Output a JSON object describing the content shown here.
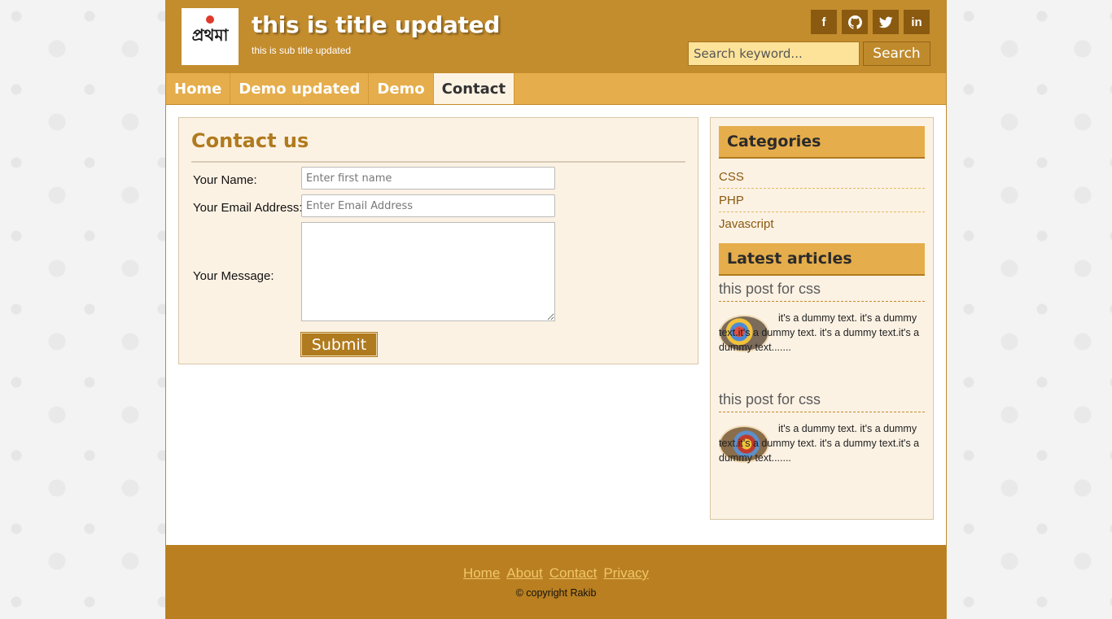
{
  "site": {
    "title": "this is title updated",
    "subtitle": "this is sub title updated",
    "logo_text": "প্রথমা"
  },
  "social": [
    {
      "icon": "facebook-icon",
      "glyph": "f"
    },
    {
      "icon": "github-icon",
      "glyph": ""
    },
    {
      "icon": "twitter-icon",
      "glyph": ""
    },
    {
      "icon": "linkedin-icon",
      "glyph": "in"
    }
  ],
  "search": {
    "placeholder": "Search keyword...",
    "button_label": "Search"
  },
  "nav": {
    "items": [
      "Home",
      "Demo updated",
      "Demo",
      "Contact"
    ],
    "active": "Contact"
  },
  "contact": {
    "title": "Contact us",
    "name_label": "Your Name:",
    "name_placeholder": "Enter first name",
    "email_label": "Your Email Address:",
    "email_placeholder": "Enter Email Address",
    "message_label": "Your Message:",
    "submit_label": "Submit"
  },
  "sidebar": {
    "categories_title": "Categories",
    "categories": [
      "CSS",
      "PHP",
      "Javascript"
    ],
    "latest_title": "Latest articles",
    "articles": [
      {
        "title": "this post for css",
        "excerpt": "it's a dummy text. it's a dummy text.it's a dummy text. it's a dummy text.it's a dummy text......."
      },
      {
        "title": "this post for css",
        "excerpt": "it's a dummy text. it's a dummy text.it's a dummy text. it's a dummy text.it's a dummy text......."
      }
    ]
  },
  "footer": {
    "links": [
      "Home",
      "About",
      "Contact",
      "Privacy"
    ],
    "copyright": "© copyright Rakib"
  },
  "colors": {
    "header": "#c38c2d",
    "nav": "#e5ad4b",
    "accent": "#b07a1e",
    "footer": "#b97f20",
    "panel": "#fcf2e4"
  }
}
